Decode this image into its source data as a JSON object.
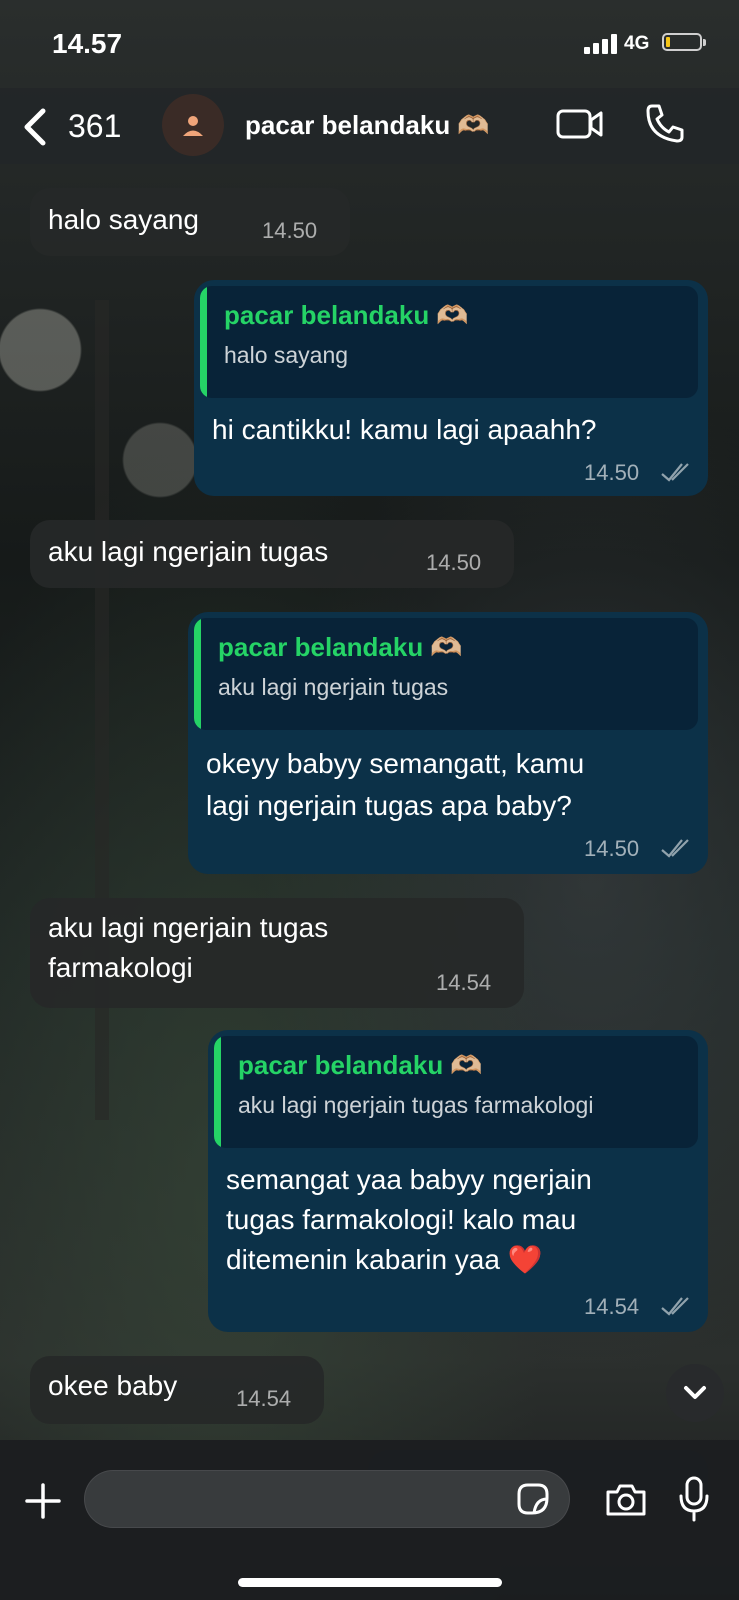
{
  "status_bar": {
    "time": "14.57",
    "network": "4G"
  },
  "header": {
    "back_count": "361",
    "contact_name": "pacar belandaku 🫶🏼"
  },
  "messages": [
    {
      "text": "halo sayang",
      "time": "14.50"
    },
    {
      "quote_name": "pacar belandaku 🫶🏼",
      "quote_text": "halo sayang",
      "lines": [
        "hi cantikku! kamu lagi apaahh?"
      ],
      "time": "14.50"
    },
    {
      "text": "aku lagi ngerjain tugas",
      "time": "14.50"
    },
    {
      "quote_name": "pacar belandaku 🫶🏼",
      "quote_text": "aku lagi ngerjain tugas",
      "lines": [
        "okeyy babyy semangatt, kamu",
        "lagi ngerjain tugas apa baby?"
      ],
      "time": "14.50"
    },
    {
      "lines": [
        "aku lagi ngerjain tugas",
        "farmakologi"
      ],
      "time": "14.54"
    },
    {
      "quote_name": "pacar belandaku 🫶🏼",
      "quote_text": "aku lagi ngerjain tugas farmakologi",
      "lines": [
        "semangat yaa babyy ngerjain",
        "tugas farmakologi! kalo mau",
        "ditemenin kabarin yaa ❤️"
      ],
      "time": "14.54"
    },
    {
      "text": "okee baby",
      "time": "14.54"
    }
  ],
  "input": {
    "placeholder": "",
    "value": ""
  },
  "icons": [
    "chevron-left-icon",
    "person-icon",
    "video-icon",
    "phone-icon",
    "chevron-down-icon",
    "plus-icon",
    "sticker-icon",
    "camera-icon",
    "microphone-icon",
    "double-check-icon"
  ],
  "colors": {
    "incoming_bubble": "#262828",
    "outgoing_bubble": "#0c3148",
    "quote_bg": "#082338",
    "accent_green": "#25d366"
  }
}
